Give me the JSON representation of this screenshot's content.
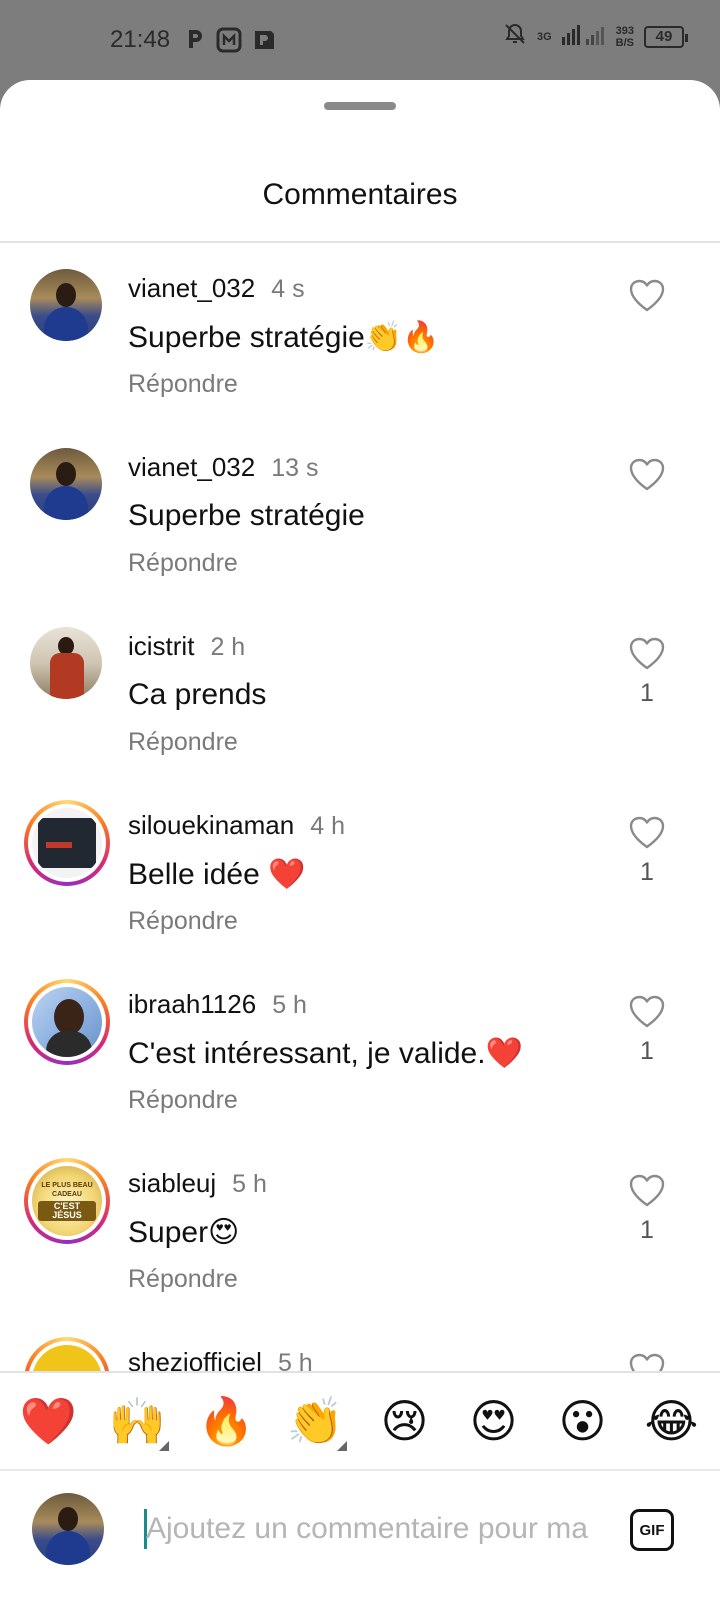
{
  "status_bar": {
    "time": "21:48",
    "network": "3G",
    "speed_value": "393",
    "speed_unit": "B/S",
    "battery": "49"
  },
  "sheet": {
    "title": "Commentaires"
  },
  "comments": [
    {
      "username": "vianet_032",
      "time": "4 s",
      "text": "Superbe stratégie👏🔥",
      "reply": "Répondre",
      "likes": "",
      "avatar": "person"
    },
    {
      "username": "vianet_032",
      "time": "13 s",
      "text": "Superbe stratégie",
      "reply": "Répondre",
      "likes": "",
      "avatar": "person"
    },
    {
      "username": "icistrit",
      "time": "2 h",
      "text": "Ca prends",
      "reply": "Répondre",
      "likes": "1",
      "avatar": "back"
    },
    {
      "username": "silouekinaman",
      "time": "4 h",
      "text": "Belle idée ❤️",
      "reply": "Répondre",
      "likes": "1",
      "avatar": "dark"
    },
    {
      "username": "ibraah1126",
      "time": "5 h",
      "text": "C'est intéressant, je valide.❤️",
      "reply": "Répondre",
      "likes": "1",
      "avatar": "blue"
    },
    {
      "username": "siableuj",
      "time": "5 h",
      "text": "Super😍",
      "reply": "Répondre",
      "likes": "1",
      "avatar": "jesus"
    },
    {
      "username": "sheziofficiel",
      "time": "5 h",
      "text": "",
      "reply": "",
      "likes": "",
      "avatar": "gold"
    }
  ],
  "avatar_text": {
    "jesus_line1": "LE PLUS BEAU CADEAU",
    "jesus_line2": "C'EST JÉSUS"
  },
  "emoji_bar": [
    "❤️",
    "🙌",
    "🔥",
    "👏",
    "😢",
    "😍",
    "😮",
    "😂"
  ],
  "input": {
    "placeholder": "Ajoutez un commentaire pour ma",
    "gif_label": "GIF"
  },
  "colors": {
    "accent_cursor": "#1a8a8a",
    "muted_text": "#7a7a7a",
    "status_bar_bg": "#7d7d7d"
  }
}
